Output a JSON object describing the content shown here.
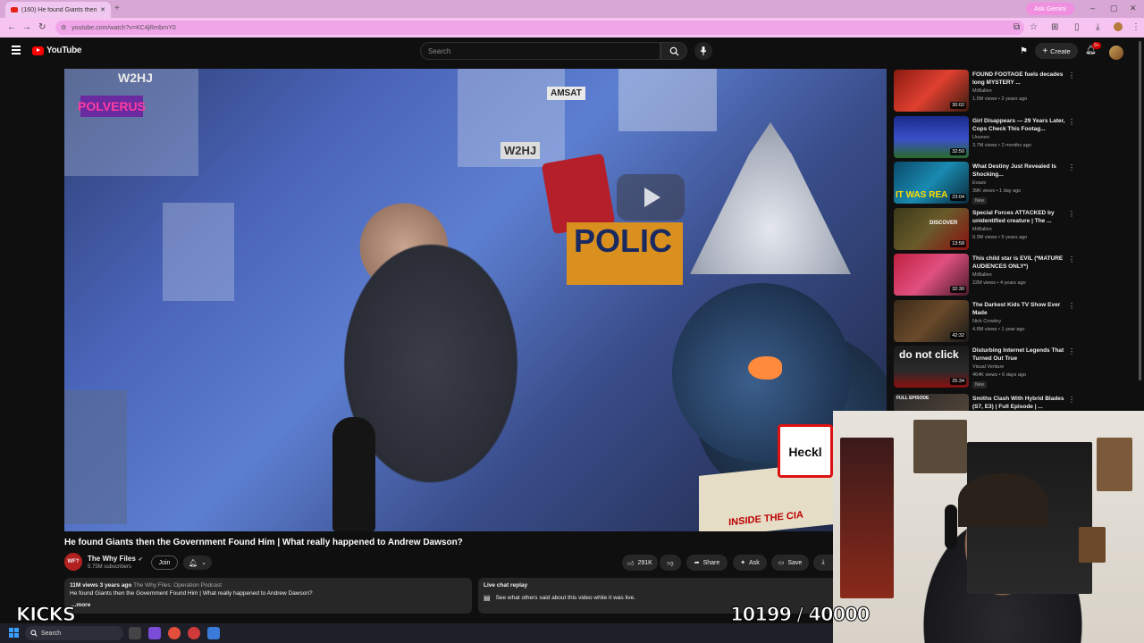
{
  "browser": {
    "tab_title": "(160) He found Giants then",
    "new_tab": "+",
    "url": "youtube.com/watch?v=KC4jRmbrnY0",
    "ask_gemini": "Ask Gemini",
    "win_min": "–",
    "win_max": "▢",
    "win_close": "✕"
  },
  "header": {
    "logo_text": "YouTube",
    "search_placeholder": "Search",
    "create_label": "Create",
    "notif_count": "9+"
  },
  "video_frame": {
    "sign_text": "Heckl",
    "book_text": "INSIDE THE CIA",
    "poster_polverus": "POLVERUS",
    "poster_w2hj": "W2HJ",
    "poster_w2hj2": "W2HJ",
    "poster_amsat": "AMSAT",
    "poster_police": "POLIC"
  },
  "video": {
    "title": "He found Giants then the Government Found Him | What really happened to Andrew Dawson?",
    "channel": "The Why Files",
    "channel_avatar_text": "WF?",
    "subscribers": "5.75M subscribers",
    "join_label": "Join",
    "like_count": "291K",
    "share_label": "Share",
    "ask_label": "Ask",
    "save_label": "Save"
  },
  "description": {
    "views_time": "11M views 3 years ago",
    "podcast_tag": "The Why Files: Operation Podcast",
    "text": "He found Giants then the Government Found Him | What really happened to Andrew Dawson?",
    "more_label": "...more"
  },
  "live_chat": {
    "title": "Live chat replay",
    "subtitle": "See what others said about this video while it was live."
  },
  "sidebar": {
    "items": [
      {
        "title": "FOUND FOOTAGE fuels decades long MYSTERY ...",
        "channel": "MrBallen",
        "meta": "1.5M views • 2 years ago",
        "duration": "30:02",
        "new": ""
      },
      {
        "title": "Girl Disappears — 29 Years Later, Cops Check This Footag...",
        "channel": "Unseen",
        "meta": "3.7M views • 2 months ago",
        "duration": "32:50",
        "new": ""
      },
      {
        "title": "What Destiny Just Revealed Is Shocking...",
        "channel": "Evaze",
        "meta": "39K views • 1 day ago",
        "duration": "23:04",
        "new": "New"
      },
      {
        "title": "Special Forces ATTACKED by unidentified creature | The ...",
        "channel": "MrBallen",
        "meta": "9.3M views • 5 years ago",
        "duration": "13:58",
        "new": ""
      },
      {
        "title": "This child star is EVIL (*MATURE AUDIENCES ONLY*)",
        "channel": "MrBallen",
        "meta": "22M views • 4 years ago",
        "duration": "32:30",
        "new": ""
      },
      {
        "title": "The Darkest Kids TV Show Ever Made",
        "channel": "Nick Crowley",
        "meta": "4.8M views • 1 year ago",
        "duration": "42:32",
        "new": ""
      },
      {
        "title": "Disturbing Internet Legends That Turned Out True",
        "channel": "Visual Venture",
        "meta": "464K views • 6 days ago",
        "duration": "25:34",
        "new": "New"
      },
      {
        "title": "Smiths Clash With Hybrid Blades (S7, E3) | Full Episode | ...",
        "channel": "",
        "meta": "",
        "duration": "",
        "new": ""
      }
    ],
    "thumb_labels": {
      "t3": "IT WAS REA",
      "t4": "DISCOVER",
      "t7": "do not click",
      "t8": "FULL EPISODE"
    }
  },
  "overlays": {
    "left": "KICKS",
    "counter": "10199 / 40000"
  },
  "taskbar": {
    "search_label": "Search"
  },
  "colors": {
    "background": "#0f0f0f",
    "youtube_red": "#ff0000",
    "browser_chrome": "#f7c3f1",
    "gemini_accent": "#f08ee0"
  }
}
